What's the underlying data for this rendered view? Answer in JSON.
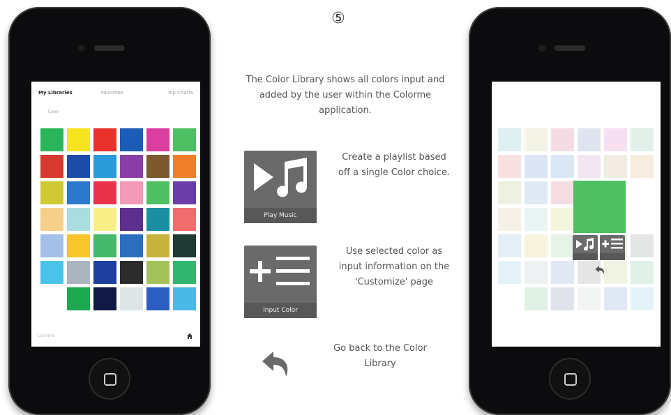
{
  "step_number": "⑤",
  "intro_text": "The Color Library shows all colors input and added by the user within the Colorme application.",
  "actions": {
    "play_music": {
      "label": "Play Music",
      "description": "Create a playlist based off a single Color choice.",
      "icon": "play-music-icon"
    },
    "input_color": {
      "label": "Input Color",
      "description": "Use selected color as input information on the 'Customize' page",
      "icon": "add-list-icon"
    },
    "back": {
      "description": "Go back to the Color Library",
      "icon": "back-arrow-icon"
    }
  },
  "left_screen": {
    "title": "My Libraries",
    "tab_favorites": "Favorites",
    "tab_recent": "Top Charts",
    "section_label": "Color",
    "footer_label": "Colorme",
    "swatches": [
      "#2bb55a",
      "#f7e31e",
      "#e8322b",
      "#1d5bb8",
      "#d93ea0",
      "#4fbf63",
      "#d63a2f",
      "#1d4ca8",
      "#2a9ad8",
      "#8a3ea8",
      "#7c5a2e",
      "#f07d2a",
      "#cfc934",
      "#2b79cf",
      "#e8334a",
      "#f29ab8",
      "#4fbf63",
      "#6a3ea8",
      "#f6d08a",
      "#a9dde0",
      "#f7ef86",
      "#5c2f8e",
      "#1b8fa2",
      "#ef6d6d",
      "#a4c0e8",
      "#f8c52a",
      "#46b86a",
      "#2b6ec0",
      "#c7b33a",
      "#1f3a34",
      "#4ac3e8",
      "#a9b4bf",
      "#1e3f9e",
      "#2b2b2b",
      "#a3c25a",
      "#32b56f",
      "",
      "#1ca84f",
      "#101a44",
      "#dde5e6",
      "#2b5ec0",
      "#4ab9e8"
    ]
  },
  "right_screen": {
    "selected_color": "#4fbf63",
    "mini_labels": {
      "play": "Play Music",
      "input": "Input Color"
    },
    "faded_swatches": [
      "#dff0f2",
      "#f4f4e6",
      "#f5dce4",
      "#dfe5f0",
      "#f6dff0",
      "#e3efe9",
      "#f7e1e1",
      "#dbe5f4",
      "#dce7f5",
      "#f3e6f0",
      "#f1ede3",
      "#f7ece0",
      "#eef0e1",
      "#dfeaf5",
      "#f4dde3",
      "",
      "",
      "",
      "#f6f1e6",
      "#e9f5f5",
      "#f5f5df",
      "",
      "",
      "",
      "#e6eef5",
      "#f6f3df",
      "#e7f3e9",
      "",
      "#f2f2e3",
      "#e3e6e5",
      "#e4f3f8",
      "#eef0f2",
      "#e2e7f4",
      "#e6e6e6",
      "#f0f3e4",
      "#e0f2e7",
      "",
      "#dff1e4",
      "#e1e3ea",
      "#f3f5f5",
      "#e0e8f5",
      "#e2f2f8"
    ]
  }
}
